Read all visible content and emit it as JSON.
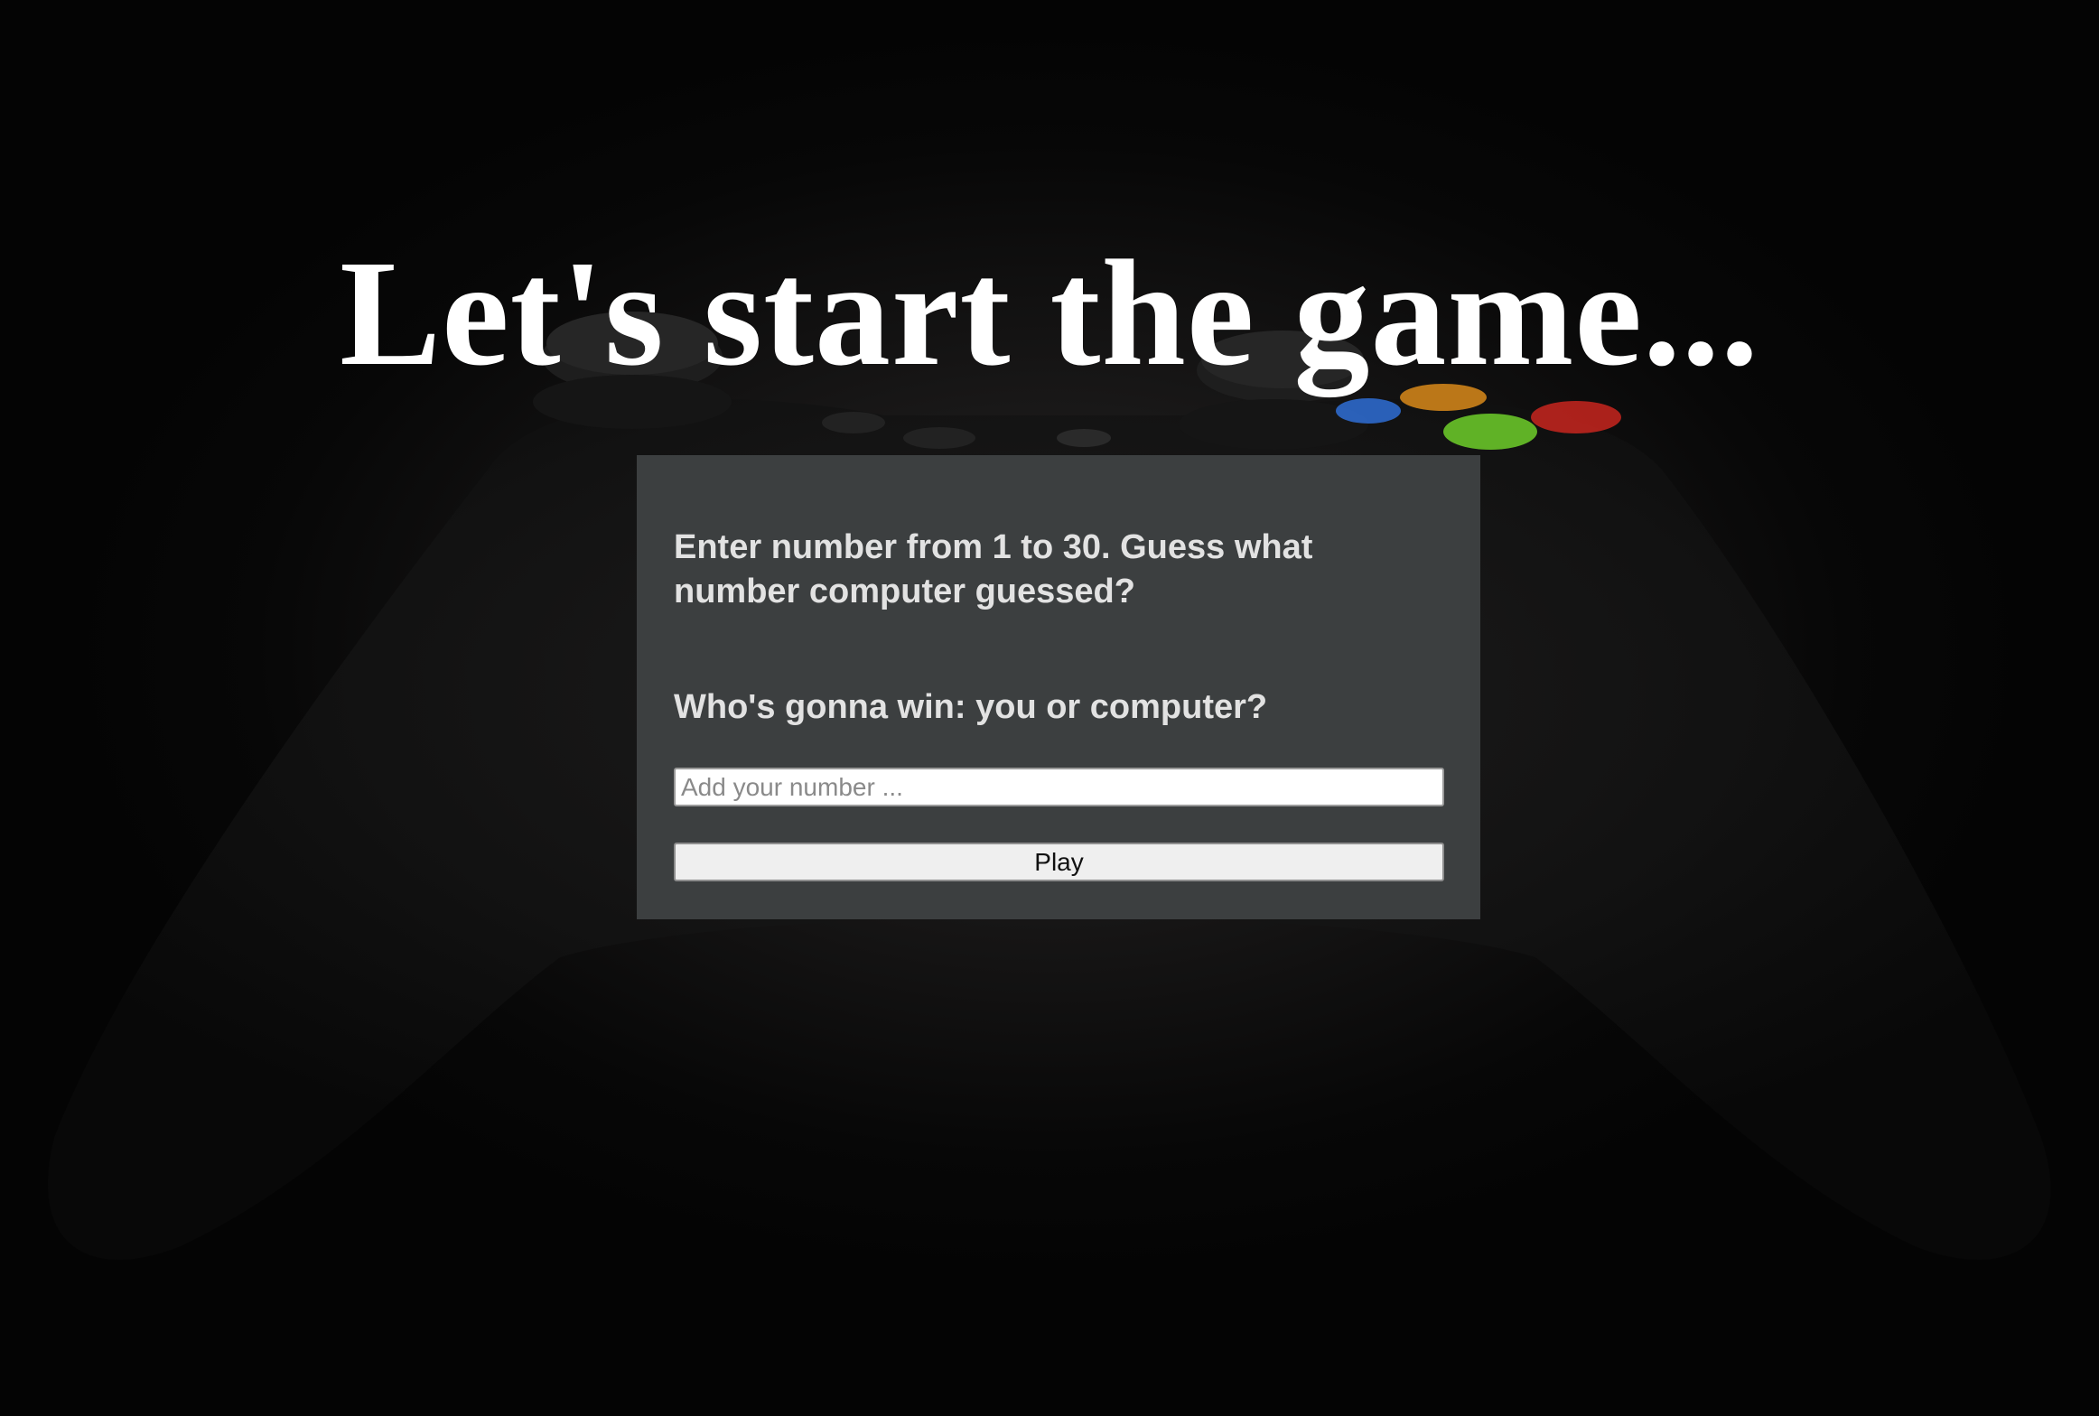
{
  "page": {
    "title": "Let's start the game..."
  },
  "game": {
    "instruction": "Enter number from 1 to 30. Guess what number computer guessed?",
    "question": "Who's gonna win: you or computer?",
    "input_placeholder": "Add your number ...",
    "play_label": "Play"
  },
  "background": {
    "image": "game-controller-photo",
    "button_colors": [
      "#2f6fd6",
      "#d98a1a",
      "#6fcf2a",
      "#c8261e"
    ]
  },
  "colors": {
    "panel": "#3c3f40",
    "panel_text": "#e2e2e2",
    "title": "#ffffff"
  }
}
